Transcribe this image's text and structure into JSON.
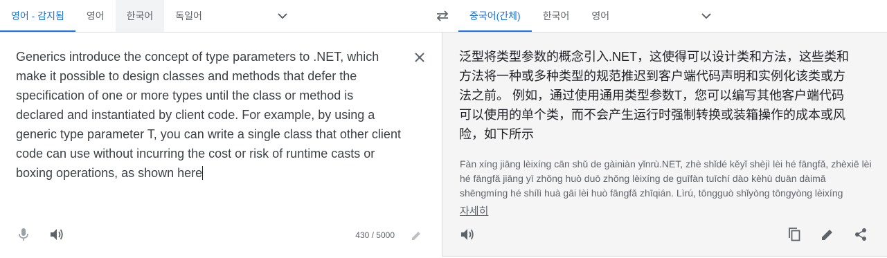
{
  "source_langs": {
    "tabs": [
      {
        "label": "영어 - 감지됨"
      },
      {
        "label": "영어"
      },
      {
        "label": "한국어"
      },
      {
        "label": "독일어"
      }
    ]
  },
  "target_langs": {
    "tabs": [
      {
        "label": "중국어(간체)"
      },
      {
        "label": "한국어"
      },
      {
        "label": "영어"
      }
    ]
  },
  "source": {
    "text": "Generics introduce the concept of type parameters to .NET, which make it possible to design classes and methods that defer the specification of one or more types until the class or method is declared and instantiated by client code. For example, by using a generic type parameter T, you can write a single class that other client code can use without incurring the cost or risk of runtime casts or boxing operations, as shown here",
    "char_count": "430 / 5000"
  },
  "target": {
    "text": "泛型将类型参数的概念引入.NET，这使得可以设计类和方法，这些类和方法将一种或多种类型的规范推迟到客户端代码声明和实例化该类或方法之前。 例如，通过使用通用类型参数T，您可以编写其他客户端代码可以使用的单个类，而不会产生运行时强制转换或装箱操作的成本或风险，如下所示",
    "romanization": "Fàn xíng jiāng lèixíng cān shǔ de gàiniàn yǐnrù.NET, zhè shǐdé kěyǐ shèjì lèi hé fāngfǎ, zhèxiē lèi hé fāngfǎ jiāng yī zhǒng huò duō zhǒng lèixíng de guīfàn tuīchí dào kèhù duān dàimǎ shēngmíng hé shílì huà gāi lèi huò fāngfǎ zhīqián. Lìrú, tōngguò shǐyòng tōngyòng lèixíng cānshù T, nín kěyǐ biānxiě qítā kèhù duān dàimǎ kěyǐ shǐyòng de dān gè lèi",
    "more_label": "자세히"
  },
  "colors": {
    "accent": "#1a73e8",
    "icon": "#5f6368",
    "panel_bg": "#f5f5f5"
  }
}
